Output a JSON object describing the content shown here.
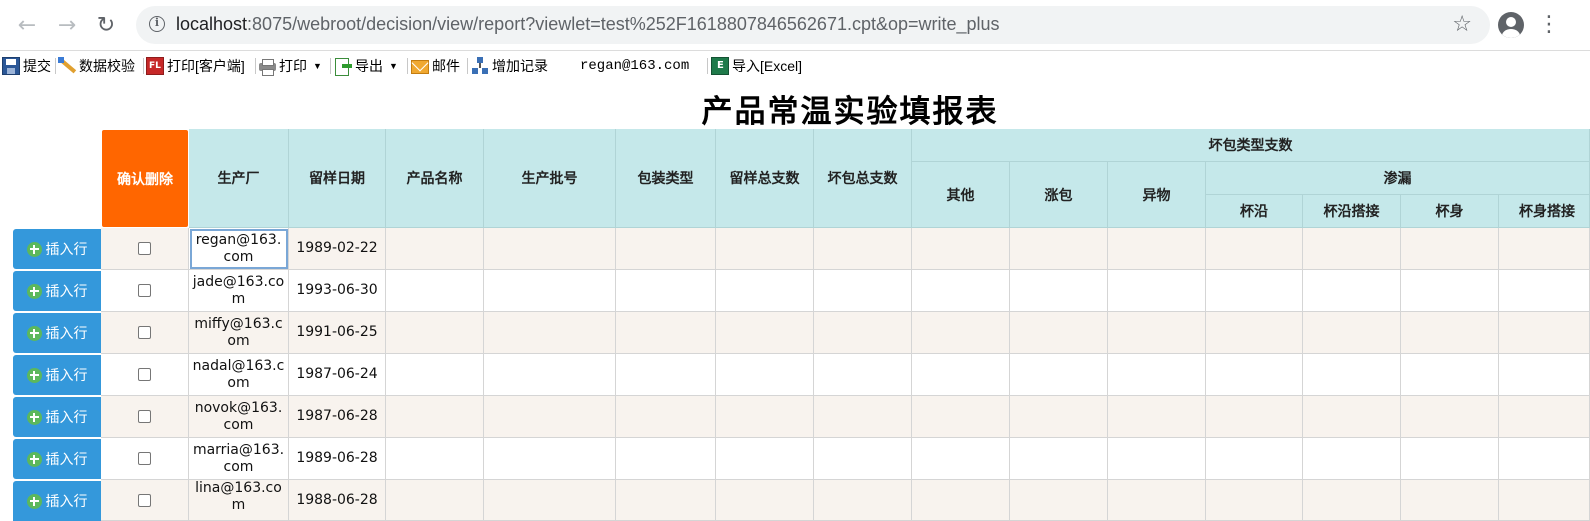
{
  "browser": {
    "url_host": "localhost",
    "url_rest": ":8075/webroot/decision/view/report?viewlet=test%252F1618807846562671.cpt&op=write_plus",
    "back_icon": "arrow-left-icon",
    "forward_icon": "arrow-right-icon",
    "reload_icon": "reload-icon"
  },
  "toolbar": {
    "submit": "提交",
    "validate": "数据校验",
    "print_client": "打印[客户端]",
    "print": "打印",
    "export": "导出",
    "mail": "邮件",
    "add_record": "增加记录",
    "user": "regan@163.com",
    "import_excel": "导入[Excel]"
  },
  "report": {
    "title": "产品常温实验填报表",
    "headers": {
      "confirm_delete": "确认删除",
      "factory": "生产厂",
      "sample_date": "留样日期",
      "product_name": "产品名称",
      "batch": "生产批号",
      "package_type": "包装类型",
      "total_samples": "留样总支数",
      "total_broken": "坏包总支数",
      "broken_type_group": "坏包类型支数",
      "other": "其他",
      "swell": "涨包",
      "foreign": "异物",
      "leak_group": "渗漏",
      "cup_edge": "杯沿",
      "cup_edge_joint": "杯沿搭接",
      "cup_body": "杯身",
      "cup_body_joint": "杯身搭接"
    },
    "insert_label": "插入行",
    "rows": [
      {
        "factory": "regan@163.com",
        "date": "1989-02-22"
      },
      {
        "factory": "jade@163.com",
        "date": "1993-06-30"
      },
      {
        "factory": "miffy@163.com",
        "date": "1991-06-25"
      },
      {
        "factory": "nadal@163.com",
        "date": "1987-06-24"
      },
      {
        "factory": "novok@163.com",
        "date": "1987-06-28"
      },
      {
        "factory": "marria@163.com",
        "date": "1989-06-28"
      },
      {
        "factory": "lina@163.com",
        "date": "1988-06-28"
      }
    ]
  }
}
